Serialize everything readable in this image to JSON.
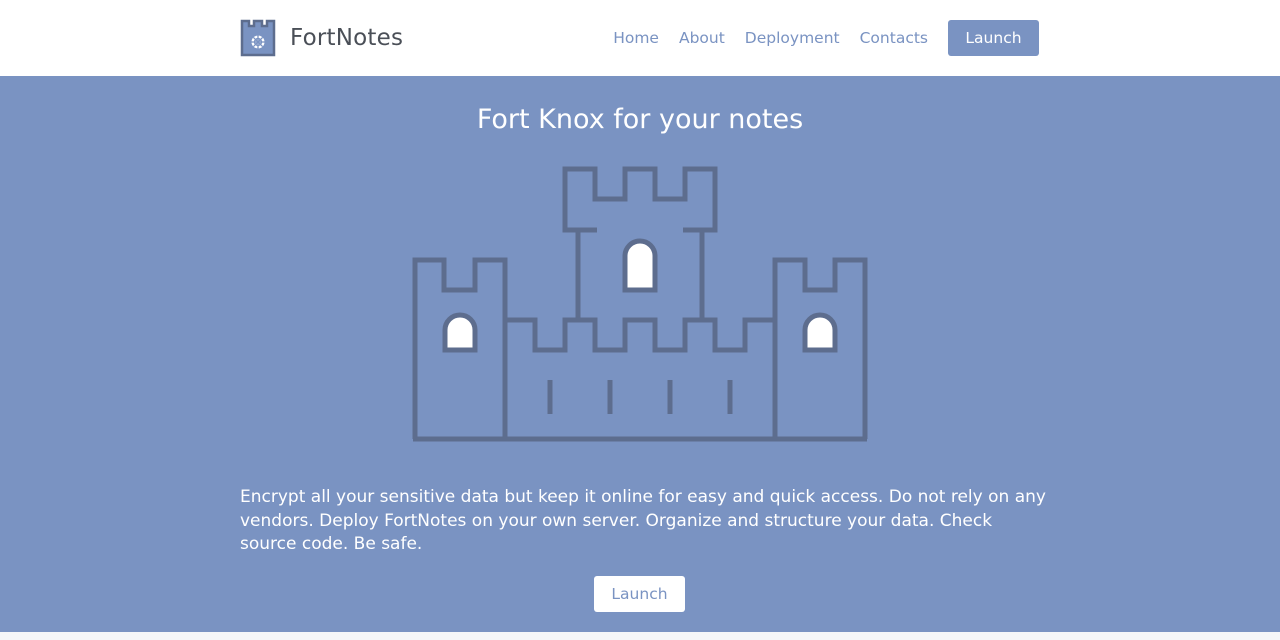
{
  "brand": {
    "name": "FortNotes",
    "logo_icon": "castle-tower-icon"
  },
  "nav": {
    "items": [
      {
        "label": "Home"
      },
      {
        "label": "About"
      },
      {
        "label": "Deployment"
      },
      {
        "label": "Contacts"
      }
    ],
    "launch_label": "Launch"
  },
  "hero": {
    "title": "Fort Knox for your notes",
    "illustration": "castle-icon",
    "description": "Encrypt all your sensitive data but keep it online for easy and quick access. Do not rely on any vendors. Deploy FortNotes on your own server. Organize and structure your data. Check source code. Be safe.",
    "launch_label": "Launch"
  },
  "colors": {
    "accent": "#7a93c2",
    "castle_stroke": "#5d6d8e",
    "text_dark": "#4a4f57",
    "white": "#ffffff"
  }
}
